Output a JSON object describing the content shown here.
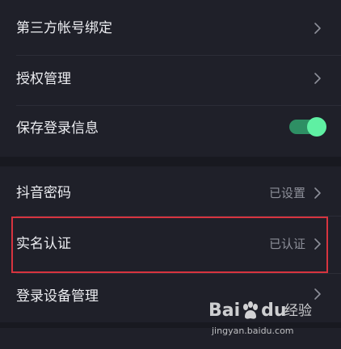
{
  "settings": {
    "items": [
      {
        "label": "第三方帐号绑定",
        "value": ""
      },
      {
        "label": "授权管理",
        "value": ""
      },
      {
        "label": "保存登录信息",
        "value": "",
        "toggle_on": true
      },
      {
        "label": "抖音密码",
        "value": "已设置"
      },
      {
        "label": "实名认证",
        "value": "已认证"
      },
      {
        "label": "登录设备管理",
        "value": ""
      }
    ]
  },
  "watermark": {
    "brand_left": "Bai",
    "brand_right": "du",
    "suffix": "经验",
    "url": "jingyan.baidu.com"
  },
  "colors": {
    "background": "#1f2029",
    "text": "#ecedf1",
    "secondary_text": "#8d8f99",
    "toggle_track": "#2e8f64",
    "toggle_knob": "#5ff0a3",
    "highlight": "#d7343f"
  },
  "icons": {
    "chevron": "chevron-right-icon",
    "toggle": "toggle-switch",
    "watermark_logo": "baidu-paw-icon"
  }
}
